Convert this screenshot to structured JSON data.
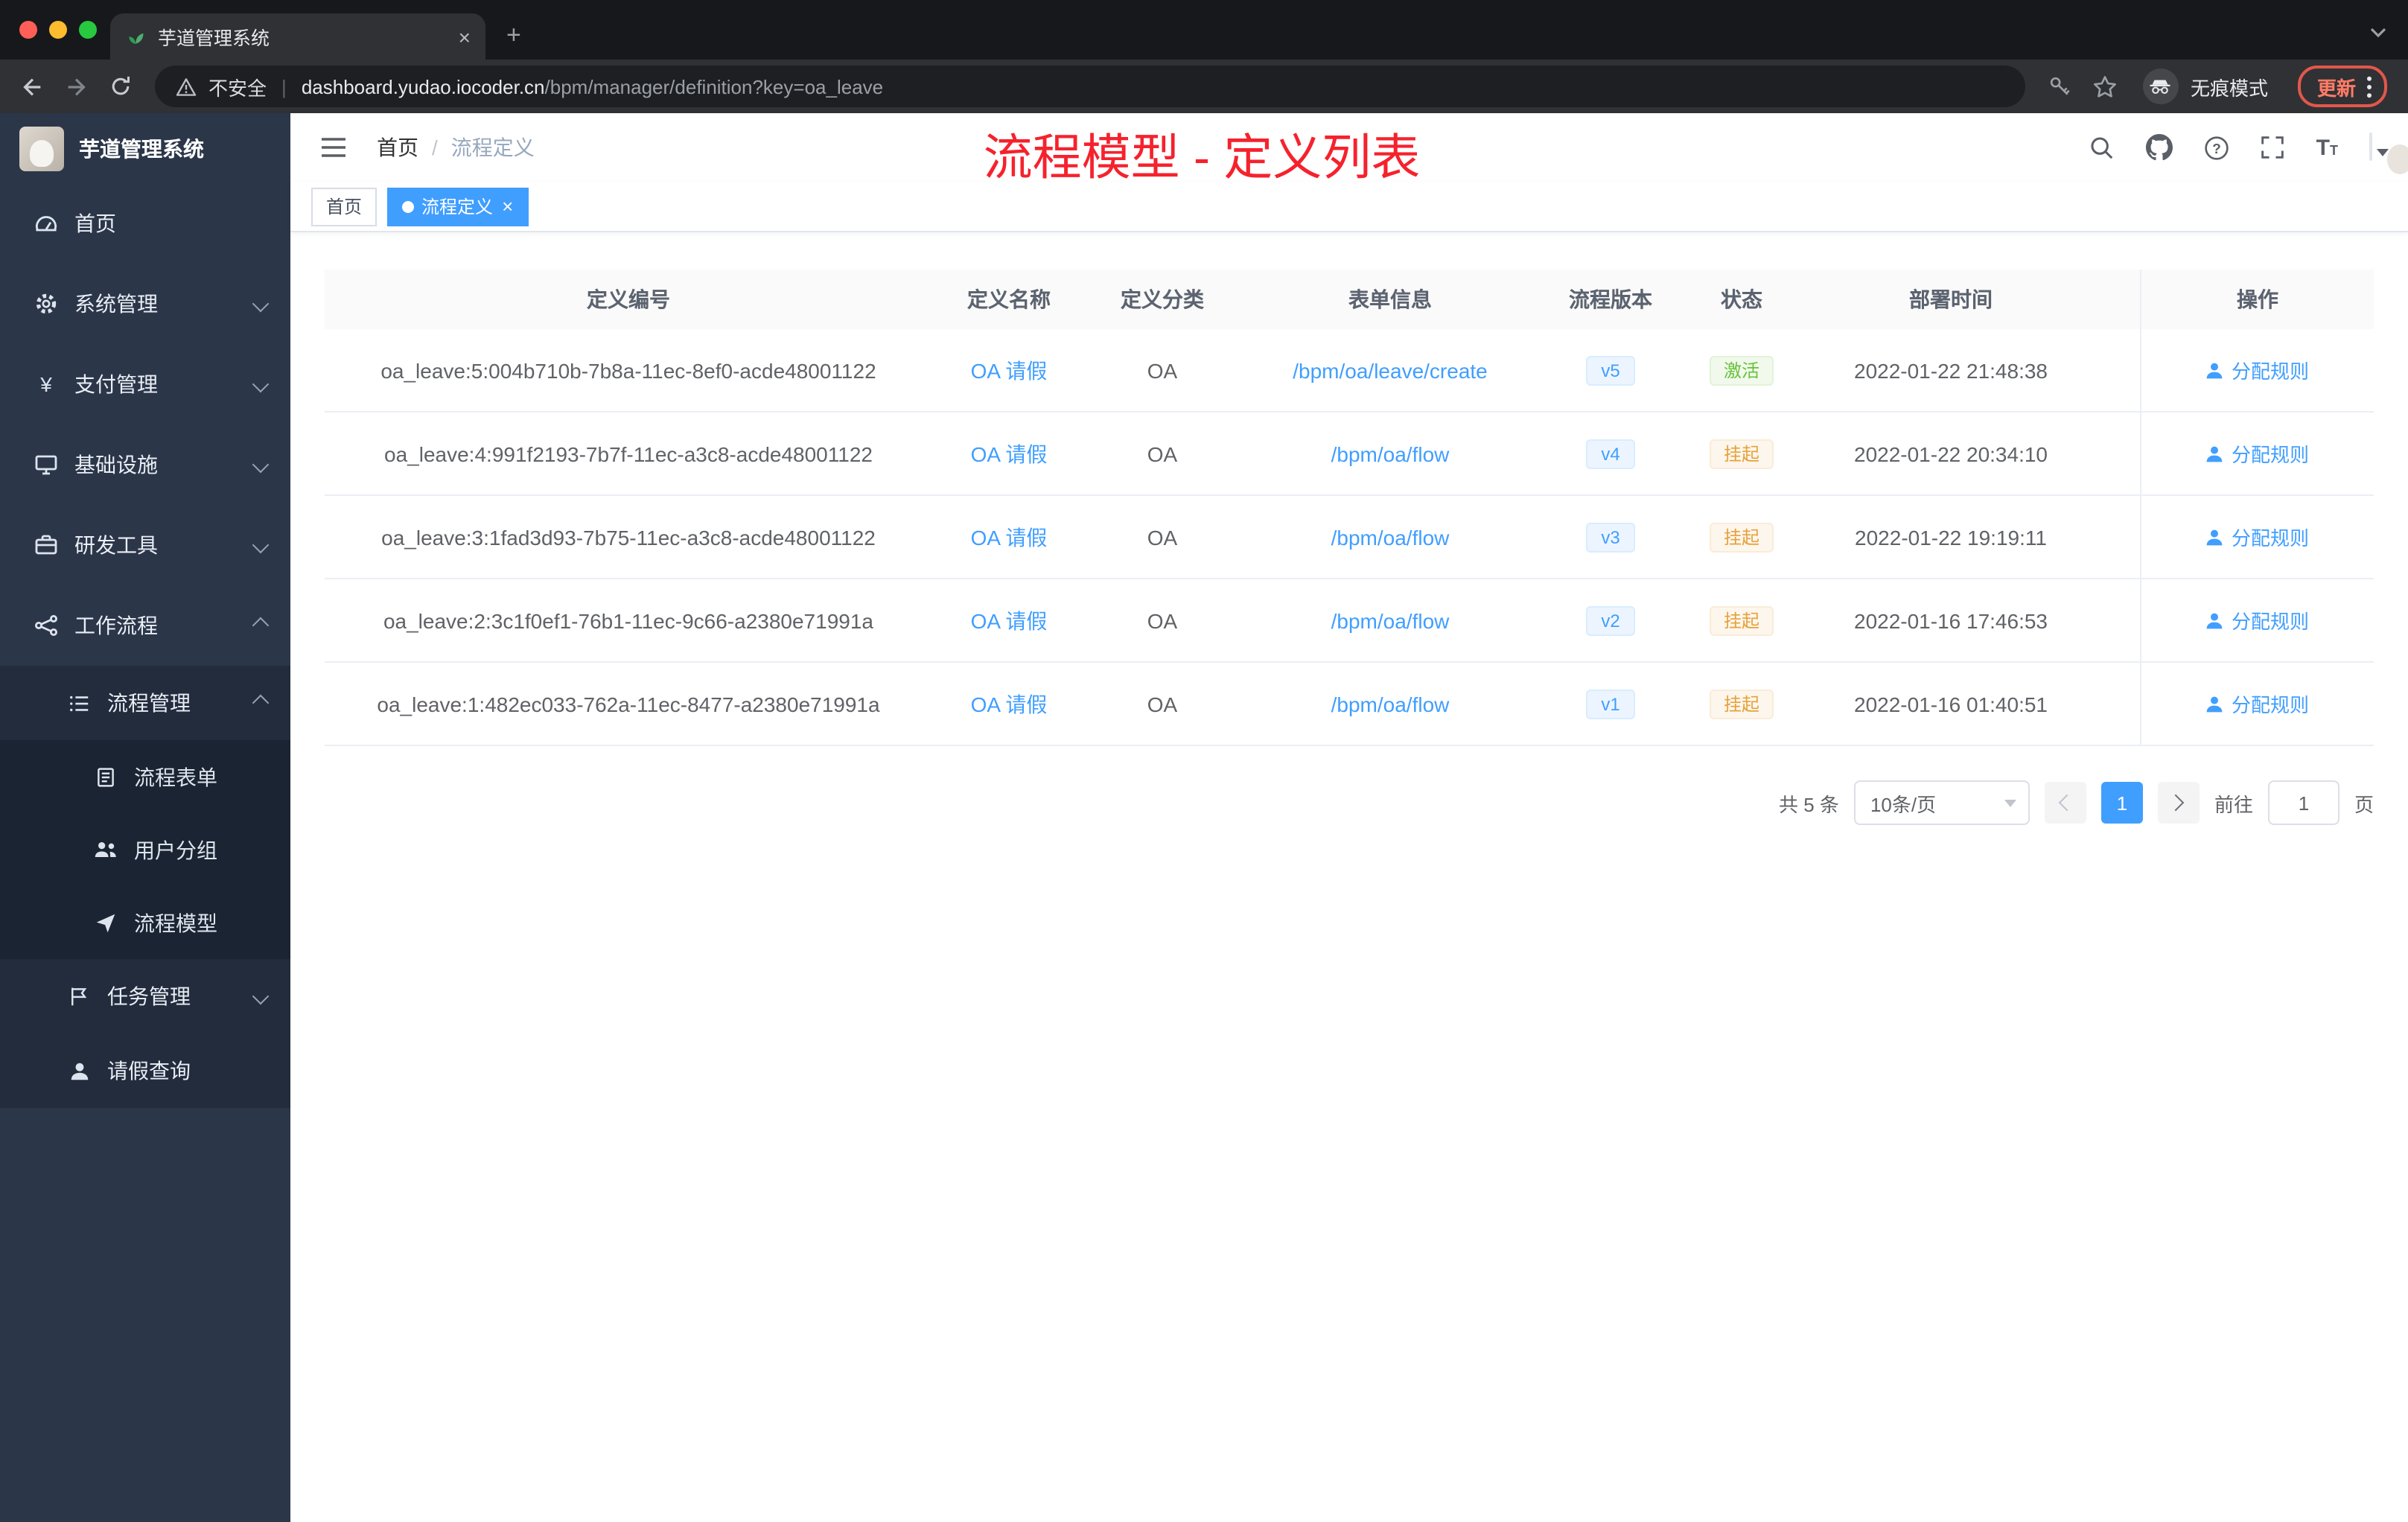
{
  "colors": {
    "accent": "#409eff",
    "success": "#67c23a",
    "warning": "#e6a23c",
    "annotation_red": "#f5222d",
    "tag_active_blue": "#409eff"
  },
  "browser": {
    "tab_title": "芋道管理系统",
    "security_label": "不安全",
    "url_domain": "dashboard.yudao.iocoder.cn",
    "url_path": "/bpm/manager/definition?key=oa_leave",
    "incognito_label": "无痕模式",
    "update_label": "更新"
  },
  "sidebar": {
    "logo_title": "芋道管理系统",
    "items": [
      {
        "label": "首页",
        "icon": "dashboard-icon"
      },
      {
        "label": "系统管理",
        "icon": "gear-icon",
        "chevron": "down"
      },
      {
        "label": "支付管理",
        "icon": "yen-icon",
        "chevron": "down"
      },
      {
        "label": "基础设施",
        "icon": "monitor-icon",
        "chevron": "down"
      },
      {
        "label": "研发工具",
        "icon": "briefcase-icon",
        "chevron": "down"
      },
      {
        "label": "工作流程",
        "icon": "workflow-icon",
        "chevron": "up"
      },
      {
        "label": "流程管理",
        "icon": "list-icon",
        "chevron": "up"
      },
      {
        "label": "流程表单",
        "icon": "form-icon"
      },
      {
        "label": "用户分组",
        "icon": "users-icon"
      },
      {
        "label": "流程模型",
        "icon": "send-icon"
      },
      {
        "label": "任务管理",
        "icon": "task-icon",
        "chevron": "down"
      },
      {
        "label": "请假查询",
        "icon": "person-icon"
      }
    ]
  },
  "header": {
    "breadcrumb_home": "首页",
    "breadcrumb_sep": "/",
    "breadcrumb_current": "流程定义",
    "annotation": "流程模型 - 定义列表"
  },
  "tags": {
    "home": "首页",
    "current": "流程定义",
    "close": "×"
  },
  "table": {
    "columns": [
      "定义编号",
      "定义名称",
      "定义分类",
      "表单信息",
      "流程版本",
      "状态",
      "部署时间",
      "操作"
    ],
    "rows": [
      {
        "id": "oa_leave:5:004b710b-7b8a-11ec-8ef0-acde48001122",
        "name": "OA 请假",
        "category": "OA",
        "form": "/bpm/oa/leave/create",
        "version": "v5",
        "status": "激活",
        "status_type": "success",
        "time": "2022-01-22 21:48:38",
        "action": "分配规则"
      },
      {
        "id": "oa_leave:4:991f2193-7b7f-11ec-a3c8-acde48001122",
        "name": "OA 请假",
        "category": "OA",
        "form": "/bpm/oa/flow",
        "version": "v4",
        "status": "挂起",
        "status_type": "warning",
        "time": "2022-01-22 20:34:10",
        "action": "分配规则"
      },
      {
        "id": "oa_leave:3:1fad3d93-7b75-11ec-a3c8-acde48001122",
        "name": "OA 请假",
        "category": "OA",
        "form": "/bpm/oa/flow",
        "version": "v3",
        "status": "挂起",
        "status_type": "warning",
        "time": "2022-01-22 19:19:11",
        "action": "分配规则"
      },
      {
        "id": "oa_leave:2:3c1f0ef1-76b1-11ec-9c66-a2380e71991a",
        "name": "OA 请假",
        "category": "OA",
        "form": "/bpm/oa/flow",
        "version": "v2",
        "status": "挂起",
        "status_type": "warning",
        "time": "2022-01-16 17:46:53",
        "action": "分配规则"
      },
      {
        "id": "oa_leave:1:482ec033-762a-11ec-8477-a2380e71991a",
        "name": "OA 请假",
        "category": "OA",
        "form": "/bpm/oa/flow",
        "version": "v1",
        "status": "挂起",
        "status_type": "warning",
        "time": "2022-01-16 01:40:51",
        "action": "分配规则"
      }
    ]
  },
  "pagination": {
    "total": "共 5 条",
    "page_size": "10条/页",
    "current_page": "1",
    "goto_label": "前往",
    "goto_value": "1",
    "unit_label": "页"
  }
}
